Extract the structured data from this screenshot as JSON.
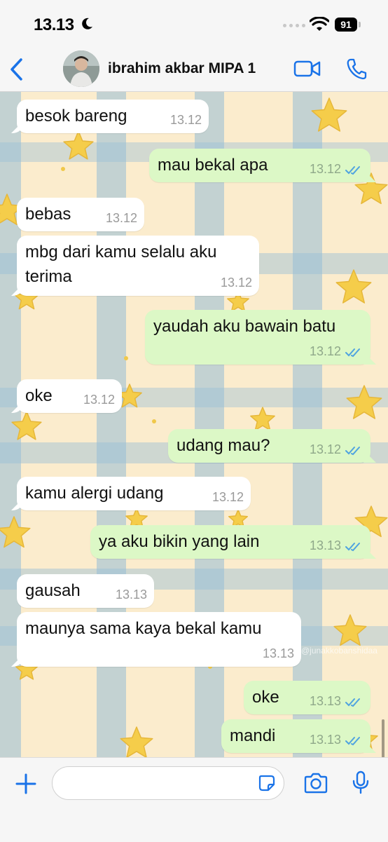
{
  "status": {
    "time": "13.13",
    "battery": "91"
  },
  "header": {
    "contact_name": "ibrahim akbar MIPA 1"
  },
  "colors": {
    "accent": "#1a73e8",
    "outgoing": "#dcf8c6",
    "incoming": "#ffffff",
    "read_ticks": "#4fa3e0",
    "wallpaper": "#fbeccd"
  },
  "icons": [
    "moon-icon",
    "wifi-icon",
    "battery-icon",
    "back-icon",
    "video-call-icon",
    "phone-icon",
    "plus-icon",
    "sticker-icon",
    "camera-icon",
    "microphone-icon",
    "read-ticks-icon"
  ],
  "messages": [
    {
      "text": "besok bareng",
      "time": "13.12",
      "from": "in"
    },
    {
      "text": "mau bekal apa",
      "time": "13.12",
      "from": "out"
    },
    {
      "text": "bebas",
      "time": "13.12",
      "from": "in"
    },
    {
      "text": "mbg dari kamu selalu aku terima",
      "time": "13.12",
      "from": "in"
    },
    {
      "text": "yaudah aku bawain batu",
      "time": "13.12",
      "from": "out"
    },
    {
      "text": "oke",
      "time": "13.12",
      "from": "in"
    },
    {
      "text": "udang mau?",
      "time": "13.12",
      "from": "out"
    },
    {
      "text": "kamu alergi udang",
      "time": "13.12",
      "from": "in"
    },
    {
      "text": "ya aku bikin yang lain",
      "time": "13.13",
      "from": "out"
    },
    {
      "text": "gausah",
      "time": "13.13",
      "from": "in"
    },
    {
      "text": "maunya sama kaya bekal kamu",
      "time": "13.13",
      "from": "in"
    },
    {
      "text": "oke",
      "time": "13.13",
      "from": "out"
    },
    {
      "text": "mandi",
      "time": "13.13",
      "from": "out"
    }
  ],
  "watermark": "@junakkobanshidaa",
  "composer": {
    "placeholder": ""
  }
}
